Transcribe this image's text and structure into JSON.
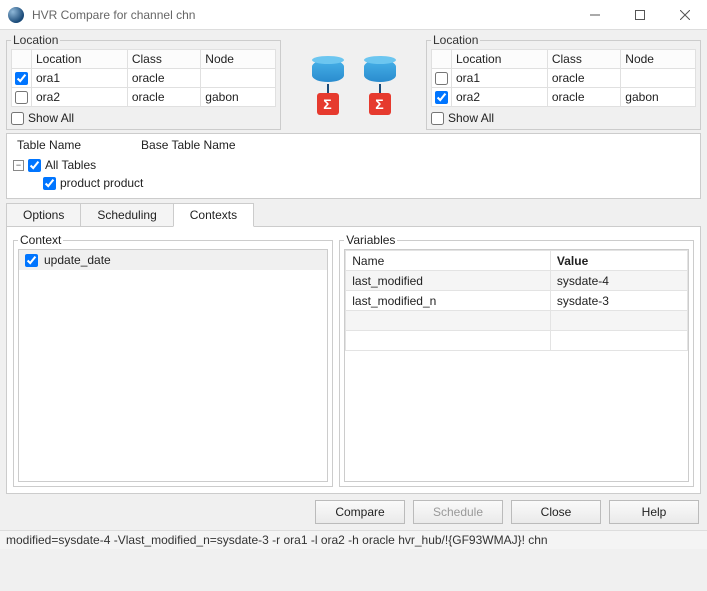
{
  "window": {
    "title": "HVR Compare for channel chn"
  },
  "locationLeft": {
    "legend": "Location",
    "columns": {
      "c0": "",
      "c1": "Location",
      "c2": "Class",
      "c3": "Node"
    },
    "rows": [
      {
        "checked": true,
        "location": "ora1",
        "class": "oracle",
        "node": ""
      },
      {
        "checked": false,
        "location": "ora2",
        "class": "oracle",
        "node": "gabon"
      }
    ],
    "showAll": {
      "label": "Show All",
      "checked": false
    }
  },
  "locationRight": {
    "legend": "Location",
    "columns": {
      "c0": "",
      "c1": "Location",
      "c2": "Class",
      "c3": "Node"
    },
    "rows": [
      {
        "checked": false,
        "location": "ora1",
        "class": "oracle",
        "node": ""
      },
      {
        "checked": true,
        "location": "ora2",
        "class": "oracle",
        "node": "gabon"
      }
    ],
    "showAll": {
      "label": "Show All",
      "checked": false
    }
  },
  "tables": {
    "headers": {
      "h1": "Table Name",
      "h2": "Base Table Name"
    },
    "root": {
      "label": "All Tables",
      "checked": true
    },
    "children": [
      {
        "label": "product product",
        "checked": true
      }
    ]
  },
  "tabs": {
    "t0": "Options",
    "t1": "Scheduling",
    "t2": "Contexts",
    "active": 2
  },
  "context": {
    "legend": "Context",
    "items": [
      {
        "label": "update_date",
        "checked": true
      }
    ]
  },
  "variables": {
    "legend": "Variables",
    "headers": {
      "name": "Name",
      "value": "Value"
    },
    "rows": [
      {
        "name": "last_modified",
        "value": "sysdate-4"
      },
      {
        "name": "last_modified_n",
        "value": "sysdate-3"
      }
    ]
  },
  "buttons": {
    "compare": "Compare",
    "schedule": "Schedule",
    "close": "Close",
    "help": "Help"
  },
  "status": "modified=sysdate-4 -Vlast_modified_n=sysdate-3 -r ora1 -l ora2 -h oracle hvr_hub/!{GF93WMAJ}! chn"
}
